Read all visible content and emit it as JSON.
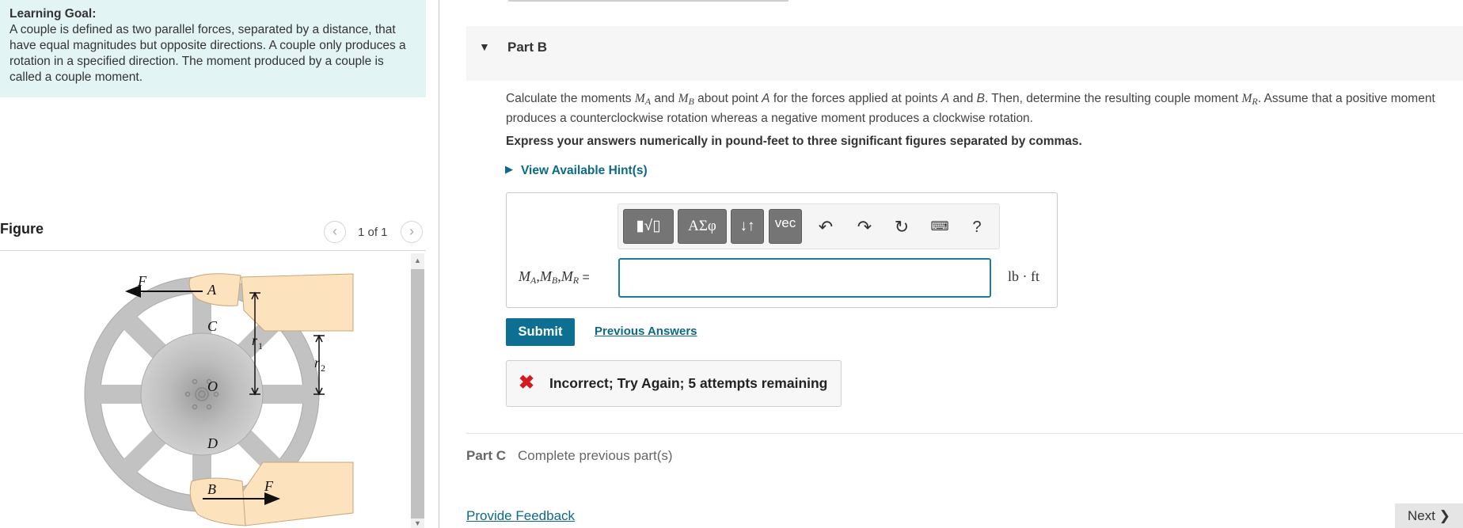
{
  "learning_goal": {
    "title": "Learning Goal:",
    "text": "A couple is defined as two parallel forces, separated by a distance, that have equal magnitudes but opposite directions. A couple only produces a rotation in a specified direction. The moment produced by a couple is called a couple moment."
  },
  "figure": {
    "title": "Figure",
    "counter": "1 of 1",
    "prev_icon": "chevron-left-icon",
    "next_icon": "chevron-right-icon",
    "labels": {
      "F_top": "F",
      "A": "A",
      "C": "C",
      "O": "O",
      "D": "D",
      "B": "B",
      "F_bottom": "F",
      "r1": "r",
      "r1_sub": "1",
      "r2": "r",
      "r2_sub": "2"
    }
  },
  "part_b": {
    "label": "Part B",
    "question": {
      "t1": "Calculate the moments ",
      "MA": "M",
      "MA_sub": "A",
      "t2": " and ",
      "MB": "M",
      "MB_sub": "B",
      "t3": " about point ",
      "A": "A",
      "t4": " for the forces applied at points ",
      "A2": "A",
      "t5": " and ",
      "B": "B",
      "t6": ". Then, determine the resulting couple moment ",
      "MR": "M",
      "MR_sub": "R",
      "t7": ". Assume that a positive moment produces a counterclockwise rotation whereas a negative moment produces a clockwise rotation."
    },
    "instruction": "Express your answers numerically in pound-feet to three significant figures separated by commas.",
    "hint_link": "View Available Hint(s)",
    "toolbar": {
      "template_label": "▮√▯",
      "greek_label": "ΑΣφ",
      "arrows_label": "↓↑",
      "vec_label": "vec",
      "undo_icon": "undo-icon",
      "redo_icon": "redo-icon",
      "reset_icon": "reset-icon",
      "keyboard_icon": "keyboard-icon",
      "help_label": "?"
    },
    "answer_label": {
      "m1": "M",
      "s1": "A",
      "m2": "M",
      "s2": "B",
      "m3": "M",
      "s3": "R",
      "comma": ",",
      "equals": " ="
    },
    "answer_value": "",
    "units": "lb · ft",
    "submit_label": "Submit",
    "previous_answers_label": "Previous Answers",
    "feedback": "Incorrect; Try Again; 5 attempts remaining",
    "feedback_icon": "error-x-icon"
  },
  "part_c": {
    "label": "Part C",
    "status": "Complete previous part(s)"
  },
  "footer": {
    "provide_feedback": "Provide Feedback",
    "next_label": "Next",
    "next_icon": "chevron-right-icon"
  },
  "colors": {
    "goal_bg": "#e3f4f4",
    "link": "#0d6a87",
    "submit_bg": "#0d7092",
    "error": "#d4191f",
    "input_border": "#1f7d8c"
  }
}
